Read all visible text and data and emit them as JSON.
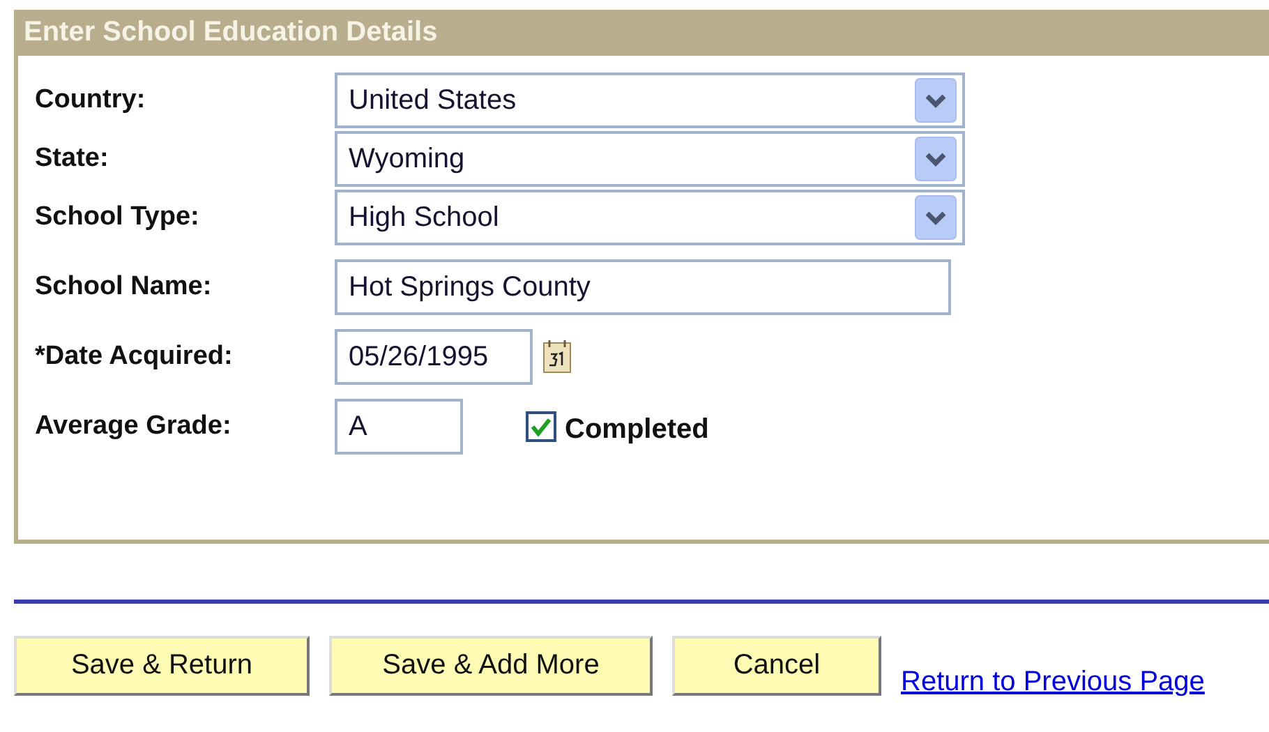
{
  "panel": {
    "title": "Enter School Education Details"
  },
  "fields": [
    {
      "label": "Country:",
      "kind": "select",
      "value": "United States"
    },
    {
      "label": "State:",
      "kind": "select",
      "value": "Wyoming"
    },
    {
      "label": "School Type:",
      "kind": "select",
      "value": "High School"
    },
    {
      "label": "School Name:",
      "kind": "text",
      "value": "Hot Springs County"
    },
    {
      "label": "*Date Acquired:",
      "kind": "date",
      "value": "05/26/1995"
    },
    {
      "label": "Average Grade:",
      "kind": "short-text",
      "value": "A",
      "checkbox": {
        "label": "Completed",
        "checked": true
      }
    }
  ],
  "buttons": [
    "Save & Return",
    "Save & Add More",
    "Cancel"
  ],
  "link": "Return to Previous Page"
}
